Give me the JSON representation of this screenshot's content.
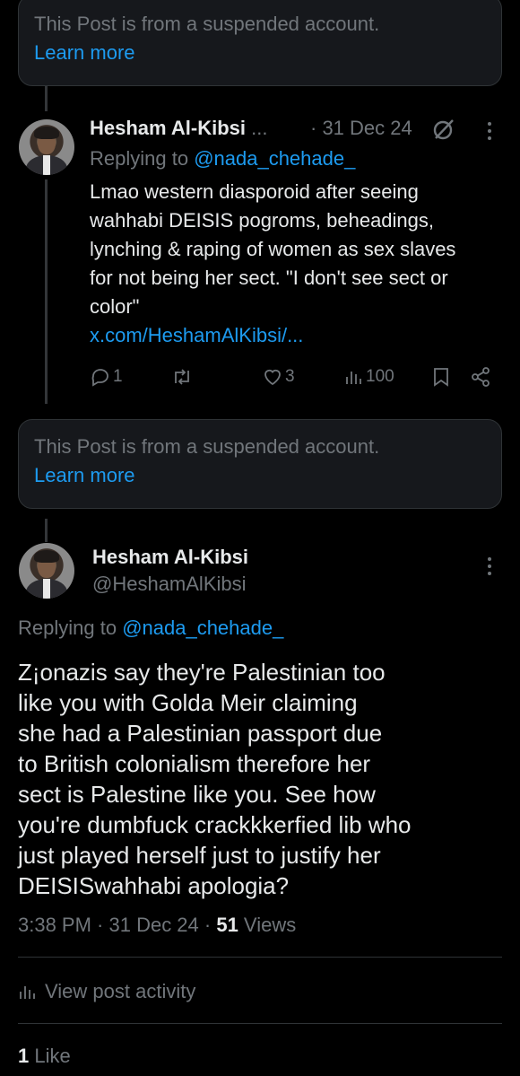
{
  "suspended_notice_1": {
    "text": "This Post is from a suspended account.",
    "link": "Learn more"
  },
  "reply_post": {
    "name": "Hesham Al-Kibsi",
    "ellipsis": "...",
    "date": "· 31 Dec 24",
    "replying_prefix": "Replying to ",
    "replying_handle": "@nada_chehade_",
    "body_lines": [
      "Lmao western diasporoid after seeing",
      "wahhabi DEISIS pogroms, beheadings,",
      "lynching & raping of women as sex slaves",
      "for not being her sect. \"I don't see sect or",
      "color\""
    ],
    "link": "x.com/HeshamAlKibsi/...",
    "actions": {
      "replies": "1",
      "reposts": "",
      "likes": "3",
      "views": "100"
    }
  },
  "suspended_notice_2": {
    "text": "This Post is from a suspended account.",
    "link": "Learn more"
  },
  "main_post": {
    "name": "Hesham Al-Kibsi",
    "handle": "@HeshamAlKibsi",
    "replying_prefix": "Replying to ",
    "replying_handle": "@nada_chehade_",
    "body_lines": [
      "Z¡onazis say they're Palestinian too",
      "like you with Golda Meir claiming",
      "she had a Palestinian passport due",
      "to British colonialism therefore her",
      "sect is Palestine like you. See how",
      "you're dumbfuck crackkkerfied lib who",
      "just played herself just to justify her",
      "DEISISwahhabi apologia?"
    ],
    "timestamp": "3:38 PM · 31 Dec 24 · ",
    "views_count": "51",
    "views_label": " Views",
    "activity_label": "View post activity",
    "likes_count": "1",
    "likes_label": " Like"
  },
  "colors": {
    "background": "#000000",
    "text": "#e7e9ea",
    "muted": "#71767b",
    "accent": "#1d9bf0",
    "border": "#2f3336"
  }
}
